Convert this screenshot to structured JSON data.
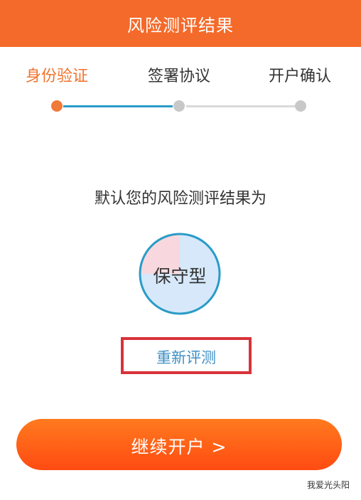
{
  "header": {
    "title": "风险测评结果"
  },
  "steps": [
    {
      "label": "身份验证",
      "status": "active"
    },
    {
      "label": "签署协议",
      "status": "pending"
    },
    {
      "label": "开户确认",
      "status": "pending"
    }
  ],
  "result": {
    "prompt": "默认您的风险测评结果为",
    "type_label": "保守型",
    "redo_label": "重新评测"
  },
  "actions": {
    "continue_label": "继续开户 >"
  },
  "watermark": {
    "text": "我爱光头阳"
  },
  "colors": {
    "header_bg": "#f46a2a",
    "active_step": "#f0742f",
    "progress_line": "#2a9bc7",
    "link": "#3e8fc4",
    "highlight_box": "#d8323a",
    "button_gradient_top": "#ff7a1e",
    "button_gradient_bottom": "#ff4b12"
  }
}
